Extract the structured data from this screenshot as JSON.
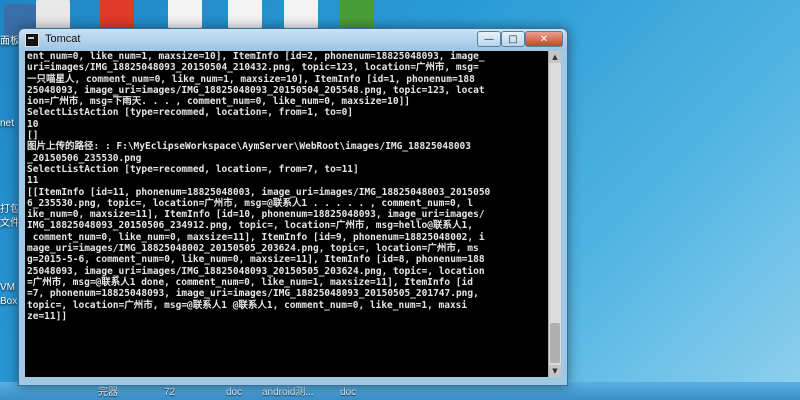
{
  "desktop": {
    "left_labels": [
      "面板",
      "打包",
      "文件",
      "VM",
      "Box",
      "net"
    ],
    "taskbar_labels": [
      "完器",
      "72",
      "doc",
      "android测...",
      "doc"
    ]
  },
  "window": {
    "title": "Tomcat",
    "minimize_glyph": "—",
    "maximize_glyph": "□",
    "close_glyph": "✕"
  },
  "console": {
    "lines": [
      "ent_num=0, like_num=1, maxsize=10], ItemInfo [id=2, phonenum=18825048093, image_",
      "uri=images/IMG_18825048093_20150504_210432.png, topic=123, location=广州市, msg=",
      "一只喵星人, comment_num=0, like_num=1, maxsize=10], ItemInfo [id=1, phonenum=188",
      "25048093, image_uri=images/IMG_18825048093_20150504_205548.png, topic=123, locat",
      "ion=广州市, msg=下雨天. . . , comment_num=0, like_num=0, maxsize=10]]",
      "SelectListAction [type=recommed, location=, from=1, to=0]",
      "10",
      "[]",
      "图片上传的路径: : F:\\MyEclipseWorkspace\\AymServer\\WebRoot\\images/IMG_18825048003",
      "_20150506_235530.png",
      "SelectListAction [type=recommed, location=, from=7, to=11]",
      "11",
      "[[ItemInfo [id=11, phonenum=18825048003, image_uri=images/IMG_18825048003_2015050",
      "6_235530.png, topic=, location=广州市, msg=@联系人1 . . . . . , comment_num=0, l",
      "ike_num=0, maxsize=11], ItemInfo [id=10, phonenum=18825048093, image_uri=images/",
      "IMG_18825048093_20150506_234912.png, topic=, location=广州市, msg=hello@联系人1,",
      " comment_num=0, like_num=0, maxsize=11], ItemInfo [id=9, phonenum=18825048002, i",
      "mage_uri=images/IMG_18825048002_20150505_203624.png, topic=, location=广州市, ms",
      "g=2015-5-6, comment_num=0, like_num=0, maxsize=11], ItemInfo [id=8, phonenum=188",
      "25048093, image_uri=images/IMG_18825048093_20150505_203624.png, topic=, location",
      "=广州市, msg=@联系人1 done, comment_num=0, like_num=1, maxsize=11], ItemInfo [id",
      "=7, phonenum=18825048093, image_uri=images/IMG_18825048093_20150505_201747.png,",
      "topic=, location=广州市, msg=@联系人1 @联系人1, comment_num=0, like_num=1, maxsi",
      "ze=11]]"
    ]
  },
  "colors": {
    "console_bg": "#000000",
    "console_text": "#e6e6e6",
    "desktop_blue": "#2a9bd6"
  }
}
